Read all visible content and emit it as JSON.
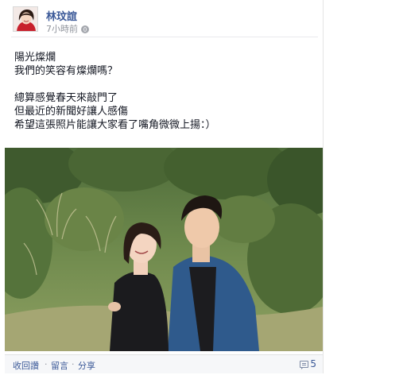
{
  "post": {
    "author": "林玟誼",
    "time": "7小時前",
    "privacy_icon": "globe-icon",
    "message_lines": [
      "陽光燦爛",
      "我們的笑容有燦爛嗎？",
      "",
      "總算感覺春天來敲門了",
      "但最近的新聞好讓人感傷",
      "希望這張照片能讓大家看了嘴角微微上揚：）"
    ],
    "photo_icon": "couple-photo"
  },
  "actions": {
    "unlike": "收回讚",
    "comment": "留言",
    "share": "分享",
    "separator": "·",
    "comment_count": "5",
    "comment_count_icon": "comment-bubble-icon"
  },
  "colors": {
    "link": "#3b5998",
    "meta": "#90949c",
    "text": "#141823",
    "footer_bg": "#f6f7f9"
  }
}
